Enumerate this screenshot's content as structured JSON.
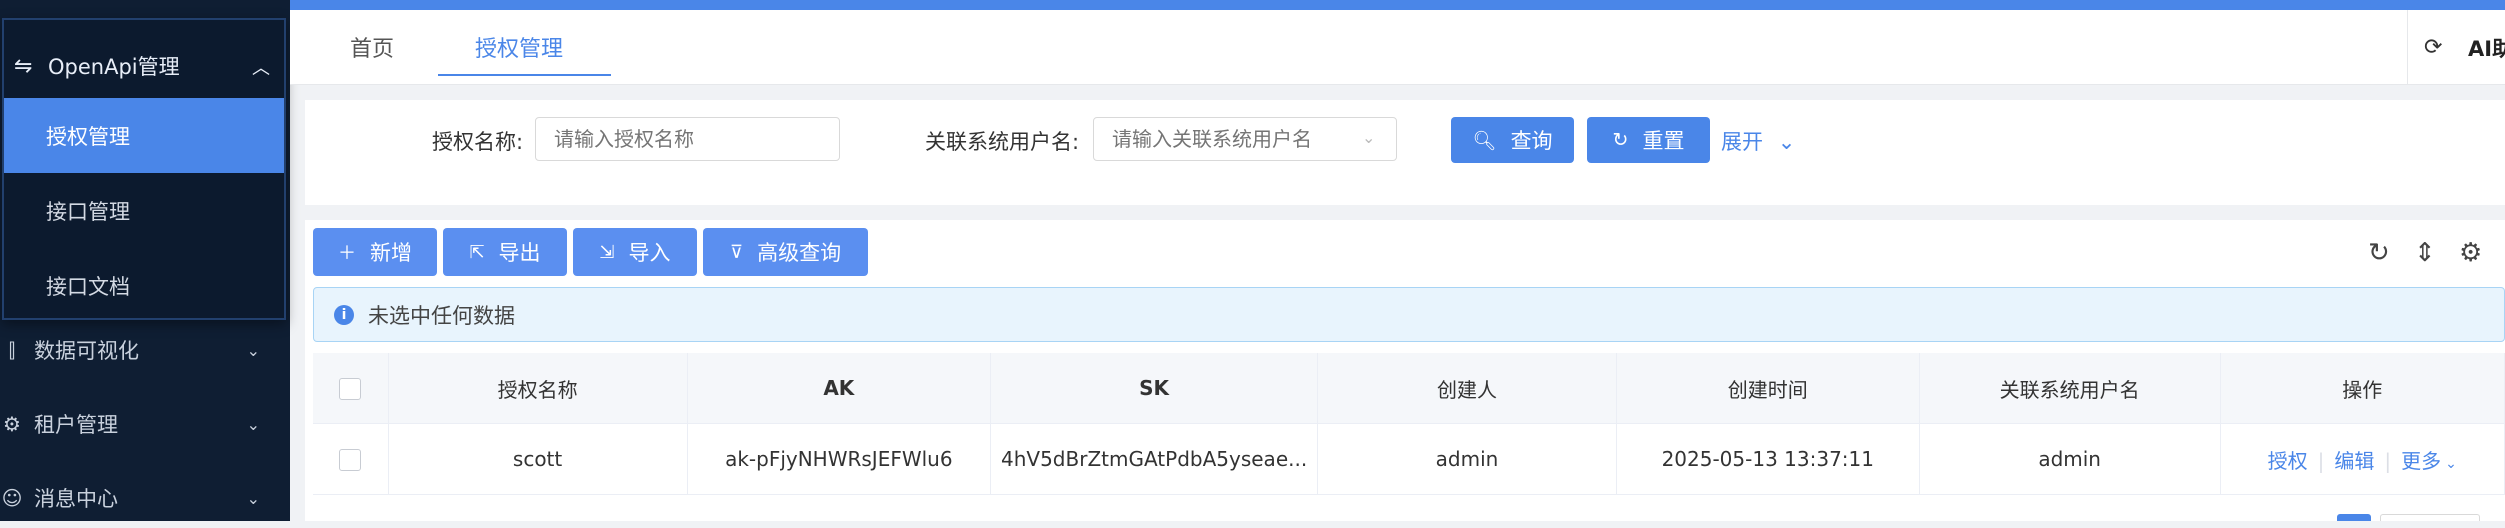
{
  "sidebar": {
    "popup": {
      "title": "OpenApi管理",
      "items": [
        {
          "label": "授权管理",
          "active": true
        },
        {
          "label": "接口管理",
          "active": false
        },
        {
          "label": "接口文档",
          "active": false
        }
      ]
    },
    "items": [
      {
        "label": "数据可视化",
        "icon": "chart-icon"
      },
      {
        "label": "租户管理",
        "icon": "gear-icon"
      },
      {
        "label": "消息中心",
        "icon": "message-icon"
      }
    ]
  },
  "tabs": [
    {
      "label": "首页",
      "active": false
    },
    {
      "label": "授权管理",
      "active": true
    }
  ],
  "header": {
    "ai_label": "AI助"
  },
  "search": {
    "name_label": "授权名称:",
    "name_placeholder": "请输入授权名称",
    "user_label": "关联系统用户名:",
    "user_placeholder": "请输入关联系统用户名",
    "query_button": "查询",
    "reset_button": "重置",
    "expand_link": "展开"
  },
  "toolbar": {
    "add": "新增",
    "export": "导出",
    "import": "导入",
    "advanced": "高级查询"
  },
  "alert": {
    "text": "未选中任何数据"
  },
  "table": {
    "headers": [
      "授权名称",
      "AK",
      "SK",
      "创建人",
      "创建时间",
      "关联系统用户名",
      "操作"
    ],
    "rows": [
      {
        "name": "scott",
        "ak": "ak-pFjyNHWRsJEFWlu6",
        "sk": "4hV5dBrZtmGAtPdbA5yseae...",
        "creator": "admin",
        "created_at": "2025-05-13 13:37:11",
        "user": "admin",
        "ops": [
          "授权",
          "编辑",
          "更多"
        ]
      }
    ]
  },
  "colors": {
    "accent": "#4a86e8",
    "sidebar_bg": "#0f1e33"
  }
}
